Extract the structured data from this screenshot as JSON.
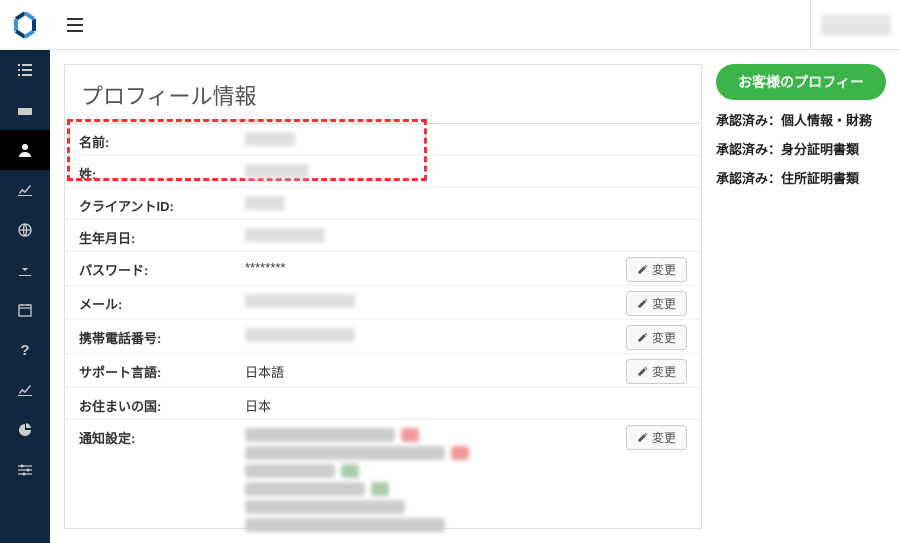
{
  "page": {
    "title": "プロフィール情報"
  },
  "profile": {
    "name_label": "名前:",
    "name_value": "",
    "surname_label": "姓:",
    "surname_value": "",
    "client_id_label": "クライアントID:",
    "client_id_value": "",
    "dob_label": "生年月日:",
    "dob_value": "",
    "password_label": "パスワード:",
    "password_value": "********",
    "email_label": "メール:",
    "email_value": "",
    "phone_label": "携帯電話番号:",
    "phone_value": "",
    "lang_label": "サポート言語:",
    "lang_value": "日本語",
    "country_label": "お住まいの国:",
    "country_value": "日本",
    "notif_label": "通知設定:",
    "change_label": "変更"
  },
  "right": {
    "green_btn": "お客様のプロフィー",
    "status": [
      "承認済み：個人情報・財務",
      "承認済み：身分証明書類",
      "承認済み：住所証明書類"
    ]
  }
}
